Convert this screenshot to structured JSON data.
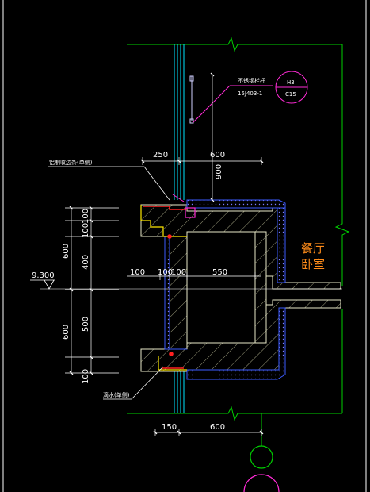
{
  "colors": {
    "background": "#000000",
    "green": "#00d000",
    "cyan": "#00e5ff",
    "blue": "#3b5bff",
    "magenta": "#ff2bd6",
    "red": "#ff2020",
    "yellow": "#ffe800",
    "orange": "#ff8c1a",
    "white": "#ffffff",
    "hatch": "#d8d8a0"
  },
  "callout": {
    "label": "不锈钢栏杆",
    "atlas_code": "15J403-1",
    "bubble_top": "H3",
    "bubble_bottom": "C15"
  },
  "notes": {
    "drip_note": "铝制收边条(单侧)",
    "flashing_note": "滴水(单侧)"
  },
  "level": {
    "elevation": "9.300"
  },
  "dimensions": {
    "top_left": "250",
    "top_right": "600",
    "rail_height": "900",
    "left_100a": "100",
    "left_100b": "100",
    "left_600a": "600",
    "left_400": "400",
    "left_600b": "600",
    "left_500": "500",
    "left_100c": "100",
    "mid_100a": "100",
    "mid_100b": "100",
    "mid_100c": "100",
    "mid_550": "550",
    "bottom_150": "150",
    "bottom_600": "600"
  },
  "rooms": {
    "room_1": "餐厅",
    "room_2": "卧室"
  }
}
